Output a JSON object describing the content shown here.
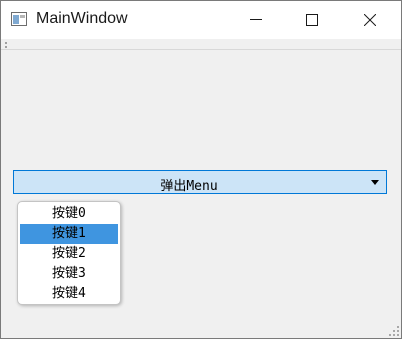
{
  "window": {
    "title": "MainWindow",
    "icon": "app-window-icon"
  },
  "titlebar_buttons": [
    {
      "name": "minimize",
      "icon": "minimize-icon"
    },
    {
      "name": "maximize",
      "icon": "maximize-icon"
    },
    {
      "name": "close",
      "icon": "close-icon"
    }
  ],
  "combo": {
    "label": "弹出Menu",
    "icon": "dropdown-arrow-icon"
  },
  "menu": {
    "items": [
      {
        "label": "按键0"
      },
      {
        "label": "按键1"
      },
      {
        "label": "按键2"
      },
      {
        "label": "按键3"
      },
      {
        "label": "按键4"
      }
    ],
    "selected_index": 1
  },
  "colors": {
    "combo_bg": "#cce4f7",
    "combo_border": "#0078d7",
    "selected_bg": "#3f95e0",
    "window_bg": "#f0f0f0"
  }
}
